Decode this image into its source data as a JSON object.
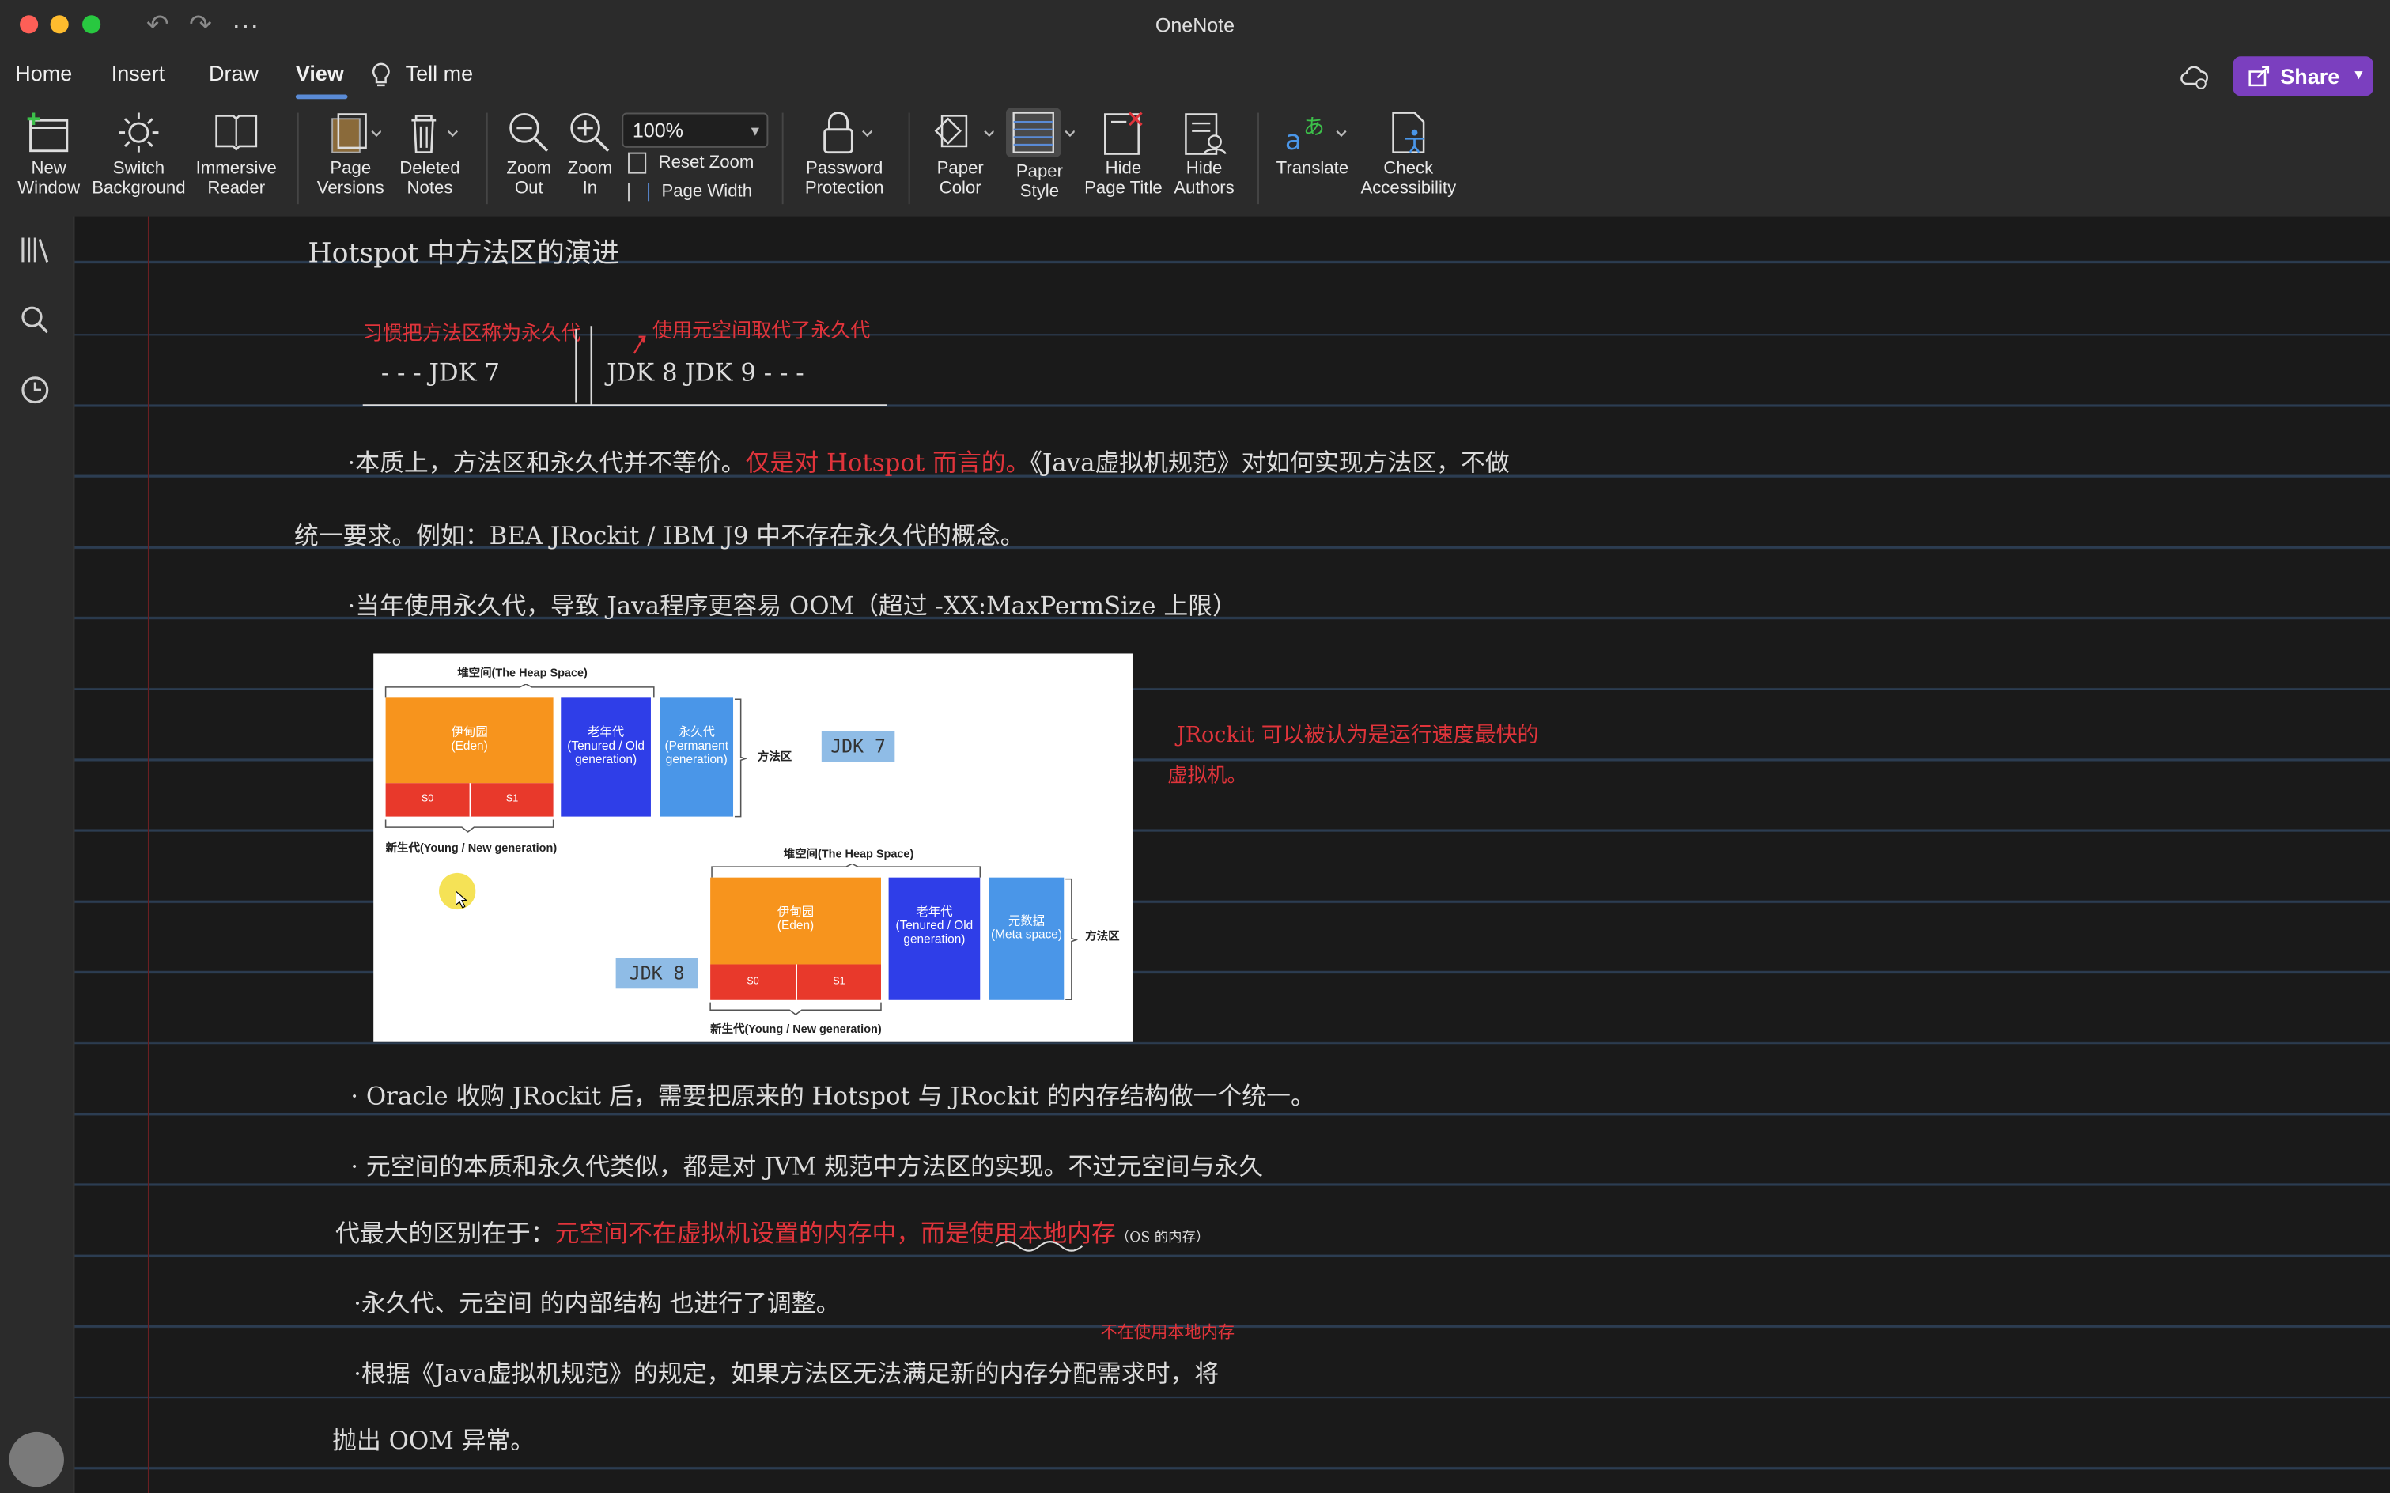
{
  "app": {
    "title": "OneNote"
  },
  "tabs": [
    {
      "label": "Home"
    },
    {
      "label": "Insert"
    },
    {
      "label": "Draw"
    },
    {
      "label": "View"
    },
    {
      "label": "Tell me"
    }
  ],
  "share_label": "Share",
  "ribbon": {
    "new_window": "New\nWindow",
    "switch_background": "Switch\nBackground",
    "immersive_reader": "Immersive\nReader",
    "page_versions": "Page\nVersions",
    "deleted_notes": "Deleted\nNotes",
    "zoom_out": "Zoom\nOut",
    "zoom_in": "Zoom\nIn",
    "zoom_value": "100%",
    "reset_zoom": "Reset Zoom",
    "page_width": "Page Width",
    "password_protection": "Password\nProtection",
    "paper_color": "Paper\nColor",
    "paper_style": "Paper\nStyle",
    "hide_page_title": "Hide\nPage Title",
    "hide_authors": "Hide\nAuthors",
    "translate": "Translate",
    "check_accessibility": "Check\nAccessibility"
  },
  "note": {
    "title": "Hotspot 中方法区的演进",
    "timeline_red_left": "习惯把方法区称为永久代",
    "timeline_red_right": "使用元空间取代了永久代",
    "timeline_left": "- - -     JDK 7",
    "timeline_right": "JDK 8    JDK 9    - - -",
    "p1_a": "·本质上，方法区和永久代并不等价。",
    "p1_red": "仅是对 Hotspot 而言的。",
    "p1_b": "《Java虚拟机规范》对如何实现方法区，不做",
    "p2": "统一要求。例如：BEA JRockit / IBM J9 中不存在永久代的概念。",
    "p3": "·当年使用永久代，导致 Java程序更容易 OOM（超过 -XX:MaxPermSize 上限）",
    "side_red_1": "JRockit 可以被认为是运行速度最快的",
    "side_red_2": "虚拟机。",
    "p4": "·  Oracle 收购 JRockit 后，需要把原来的 Hotspot 与 JRockit 的内存结构做一个统一。",
    "p5": "·  元空间的本质和永久代类似，都是对 JVM 规范中方法区的实现。不过元空间与永久",
    "p6_a": "代最大的区别在于：",
    "p6_red": "元空间不在虚拟机设置的内存中，而是使用本地内存",
    "p6_small": "（OS 的内存）",
    "side_red_3": "不在使用本地内存",
    "p7": "·永久代、元空间 的内部结构 也进行了调整。",
    "p8": "·根据《Java虚拟机规范》的规定，如果方法区无法满足新的内存分配需求时，将",
    "p9": "抛出 OOM 异常。"
  },
  "diagram": {
    "top": {
      "heap_label": "堆空间(The Heap Space)",
      "eden": "伊甸园\n(Eden)",
      "s0": "S0",
      "s1": "S1",
      "old": "老年代\n(Tenured / Old\ngeneration)",
      "perm": "永久代\n(Permanent\ngeneration)",
      "method_area": "方法区",
      "young": "新生代(Young / New generation)",
      "jdk": "JDK 7"
    },
    "bottom": {
      "heap_label": "堆空间(The Heap Space)",
      "eden": "伊甸园\n(Eden)",
      "s0": "S0",
      "s1": "S1",
      "old": "老年代\n(Tenured / Old\ngeneration)",
      "meta": "元数据\n(Meta space)",
      "method_area": "方法区",
      "young": "新生代(Young / New generation)",
      "jdk": "JDK 8"
    },
    "colors": {
      "eden": "#f7941d",
      "survivor": "#e8392b",
      "old": "#2f3ee8",
      "perm": "#4a96e8",
      "jdk": "#8fbce6"
    }
  },
  "colors": {
    "accent": "#7b3fbf",
    "tab_underline": "#5a8bd6",
    "ink_red": "#e0343b",
    "margin_red": "#6b1f22",
    "rule_blue": "#2c3d52"
  }
}
